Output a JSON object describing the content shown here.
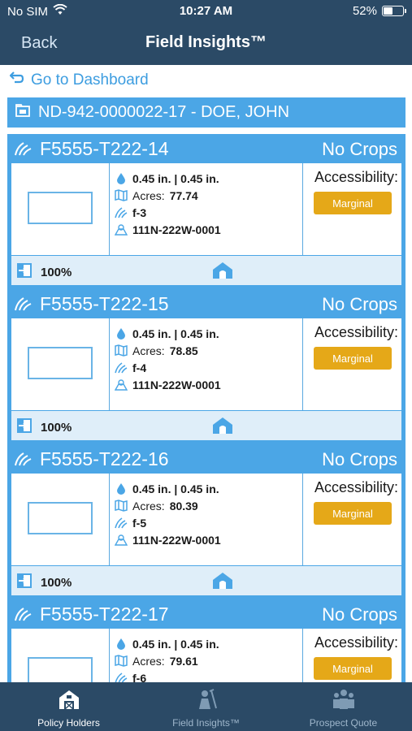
{
  "status_bar": {
    "carrier": "No SIM",
    "time": "10:27 AM",
    "battery": "52%",
    "battery_level": 0.52
  },
  "nav": {
    "back": "Back",
    "title": "Field Insights™"
  },
  "dashboard_link": "Go to Dashboard",
  "policy": {
    "label": "ND-942-0000022-17 - DOE, JOHN"
  },
  "fields": [
    {
      "name": "F5555-T222-14",
      "crop": "No Crops",
      "rain": "0.45 in. | 0.45 in.",
      "acres_label": "Acres:",
      "acres": "77.74",
      "field_id": "f-3",
      "legal": "111N-222W-0001",
      "accessibility_label": "Accessibility:",
      "accessibility": "Marginal",
      "percent": "100%"
    },
    {
      "name": "F5555-T222-15",
      "crop": "No Crops",
      "rain": "0.45 in. | 0.45 in.",
      "acres_label": "Acres:",
      "acres": "78.85",
      "field_id": "f-4",
      "legal": "111N-222W-0001",
      "accessibility_label": "Accessibility:",
      "accessibility": "Marginal",
      "percent": "100%"
    },
    {
      "name": "F5555-T222-16",
      "crop": "No Crops",
      "rain": "0.45 in. | 0.45 in.",
      "acres_label": "Acres:",
      "acres": "80.39",
      "field_id": "f-5",
      "legal": "111N-222W-0001",
      "accessibility_label": "Accessibility:",
      "accessibility": "Marginal",
      "percent": "100%"
    },
    {
      "name": "F5555-T222-17",
      "crop": "No Crops",
      "rain": "0.45 in. | 0.45 in.",
      "acres_label": "Acres:",
      "acres": "79.61",
      "field_id": "f-6",
      "legal": "",
      "accessibility_label": "Accessibility:",
      "accessibility": "Marginal",
      "percent": ""
    }
  ],
  "tabs": [
    {
      "label": "Policy Holders",
      "icon": "barn-icon",
      "active": true
    },
    {
      "label": "Field Insights™",
      "icon": "farmer-icon",
      "active": false
    },
    {
      "label": "Prospect Quote",
      "icon": "people-icon",
      "active": false
    }
  ],
  "colors": {
    "header": "#2b4a66",
    "accent": "#4ba6e6",
    "link": "#3d9de0",
    "marginal": "#e5a818",
    "footer": "#dfeef9"
  }
}
